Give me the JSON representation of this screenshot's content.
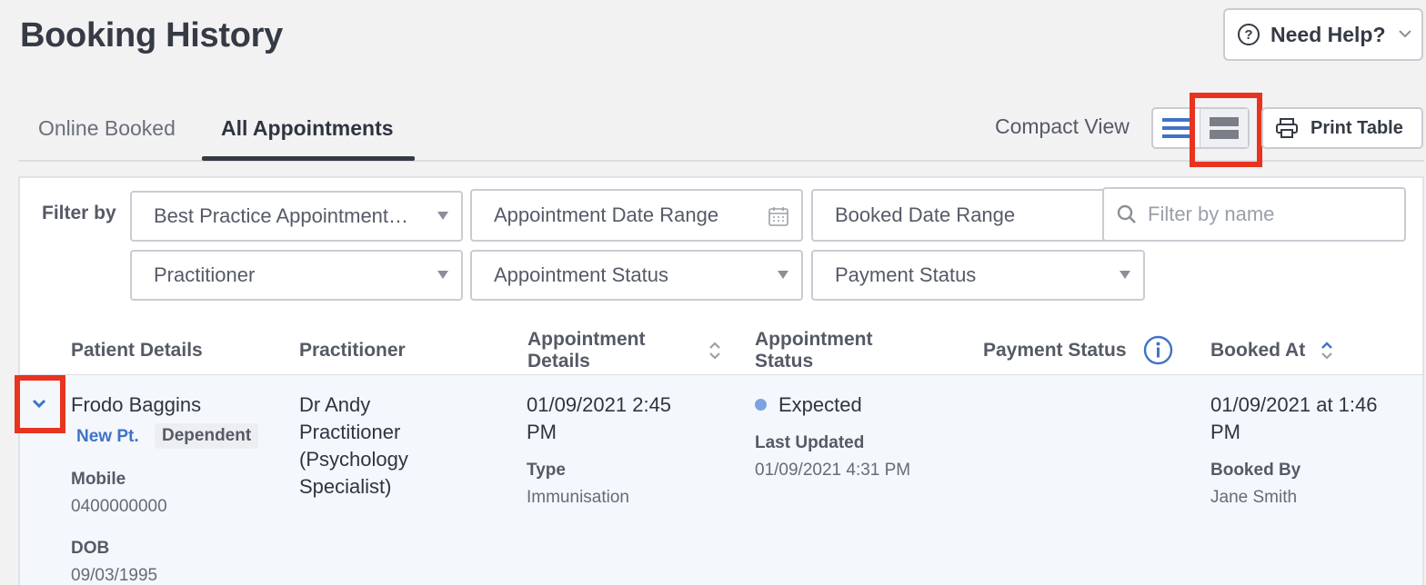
{
  "header": {
    "title": "Booking History",
    "help_label": "Need Help?",
    "help_icon": "question-circle-icon"
  },
  "tabs": [
    {
      "label": "Online Booked",
      "active": false
    },
    {
      "label": "All Appointments",
      "active": true
    }
  ],
  "toolbar": {
    "compact_label": "Compact View",
    "view_options": [
      "list-view-icon",
      "expanded-view-icon"
    ],
    "selected_view": "expanded-view-icon",
    "print_label": "Print Table",
    "highlight_color": "#e8341f"
  },
  "filters": {
    "label": "Filter by",
    "appointment_type": "Best Practice Appointment…",
    "appointment_date_range": "Appointment Date Range",
    "booked_date_range": "Booked Date Range",
    "search_placeholder": "Filter by name",
    "practitioner": "Practitioner",
    "appointment_status": "Appointment Status",
    "payment_status": "Payment Status"
  },
  "table": {
    "columns": {
      "patient": "Patient Details",
      "practitioner": "Practitioner",
      "appointment_details": "Appointment Details",
      "appointment_status": "Appointment Status",
      "payment_status": "Payment Status",
      "booked_at": "Booked At"
    },
    "rows": [
      {
        "patient_name": "Frodo Baggins",
        "badge_new": "New Pt.",
        "badge_dependent": "Dependent",
        "mobile_label": "Mobile",
        "mobile": "0400000000",
        "dob_label": "DOB",
        "dob": "09/03/1995",
        "practitioner": [
          "Dr Andy",
          "Practitioner",
          "(Psychology",
          "Specialist)"
        ],
        "appointment_datetime": [
          "01/09/2021 2:45",
          "PM"
        ],
        "type_label": "Type",
        "type": "Immunisation",
        "status": "Expected",
        "status_color": "#7aa3e0",
        "last_updated_label": "Last Updated",
        "last_updated": "01/09/2021 4:31 PM",
        "booked_at": [
          "01/09/2021 at 1:46",
          "PM"
        ],
        "booked_by_label": "Booked By",
        "booked_by": "Jane Smith"
      }
    ]
  },
  "colors": {
    "accent": "#3f73c6",
    "text": "#2f3440",
    "row_highlight": "#f4f7fc"
  }
}
